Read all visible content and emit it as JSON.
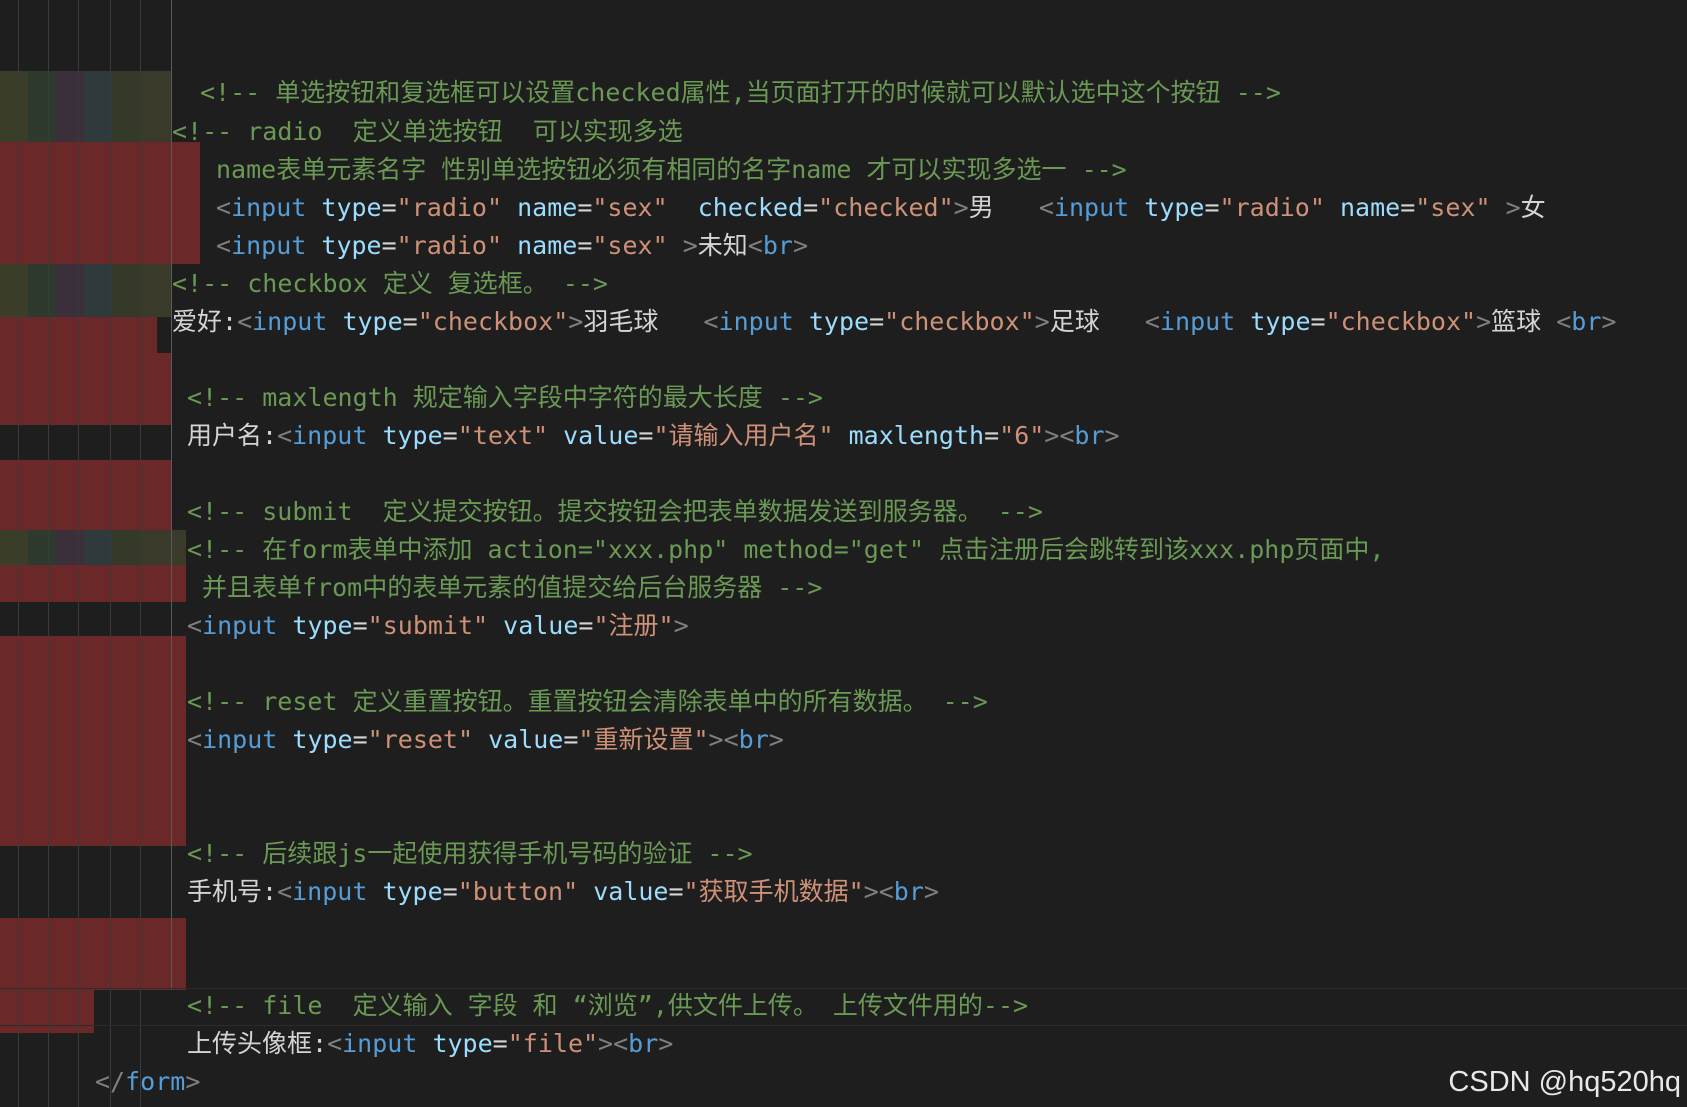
{
  "lines": {
    "l1": [
      "<!-- 单选按钮和复选框可以设置checked属性,当页面打开的时候就可以默认选中这个按钮 -->"
    ],
    "l2": [
      "<!-- radio  定义单选按钮  可以实现多选"
    ],
    "l3": [
      "name表单元素名字 性别单选按钮必须有相同的名字name 才可以实现多选一 -->"
    ],
    "l4": {
      "p1": "<",
      "t1": "input",
      "a1": "type",
      "eq1": "=",
      "v1": "\"radio\"",
      "a2": "name",
      "eq2": "=",
      "v2": "\"sex\"",
      "a3": "checked",
      "eq3": "=",
      "v3": "\"checked\"",
      "p2": ">",
      "tx1": "男",
      "p3": "<",
      "t2": "input",
      "a4": "type",
      "eq4": "=",
      "v4": "\"radio\"",
      "a5": "name",
      "eq5": "=",
      "v5": "\"sex\"",
      "p4": ">",
      "tx2": "女"
    },
    "l5": {
      "p1": "<",
      "t1": "input",
      "a1": "type",
      "eq1": "=",
      "v1": "\"radio\"",
      "a2": "name",
      "eq2": "=",
      "v2": "\"sex\"",
      "p2": ">",
      "tx1": "未知",
      "p3": "<",
      "t2": "br",
      "p4": ">"
    },
    "l6": [
      "<!-- checkbox 定义 复选框。 -->"
    ],
    "l7": {
      "tx0": "爱好:",
      "p1": "<",
      "t1": "input",
      "a1": "type",
      "eq1": "=",
      "v1": "\"checkbox\"",
      "p2": ">",
      "tx1": "羽毛球",
      "p3": "<",
      "t2": "input",
      "a2": "type",
      "eq2": "=",
      "v2": "\"checkbox\"",
      "p4": ">",
      "tx2": "足球",
      "p5": "<",
      "t3": "input",
      "a3": "type",
      "eq3": "=",
      "v3": "\"checkbox\"",
      "p6": ">",
      "tx3": "篮球",
      "p7": "<",
      "t4": "br",
      "p8": ">"
    },
    "l8": [
      "<!-- maxlength 规定输入字段中字符的最大长度 -->"
    ],
    "l9": {
      "tx0": "用户名:",
      "p1": "<",
      "t1": "input",
      "a1": "type",
      "eq1": "=",
      "v1": "\"text\"",
      "a2": "value",
      "eq2": "=",
      "v2": "\"请输入用户名\"",
      "a3": "maxlength",
      "eq3": "=",
      "v3": "\"6\"",
      "p2": ">",
      "p3": "<",
      "t2": "br",
      "p4": ">"
    },
    "l10": [
      "<!-- submit  定义提交按钮。提交按钮会把表单数据发送到服务器。 -->"
    ],
    "l11": [
      "<!-- 在form表单中添加 action=\"xxx.php\" method=\"get\" 点击注册后会跳转到该xxx.php页面中,"
    ],
    "l12": [
      "并且表单from中的表单元素的值提交给后台服务器 -->"
    ],
    "l13": {
      "p1": "<",
      "t1": "input",
      "a1": "type",
      "eq1": "=",
      "v1": "\"submit\"",
      "a2": "value",
      "eq2": "=",
      "v2": "\"注册\"",
      "p2": ">"
    },
    "l14": [
      "<!-- reset 定义重置按钮。重置按钮会清除表单中的所有数据。 -->"
    ],
    "l15": {
      "p1": "<",
      "t1": "input",
      "a1": "type",
      "eq1": "=",
      "v1": "\"reset\"",
      "a2": "value",
      "eq2": "=",
      "v2": "\"重新设置\"",
      "p2": ">",
      "p3": "<",
      "t2": "br",
      "p4": ">"
    },
    "l16": [
      "<!-- 后续跟js一起使用获得手机号码的验证 -->"
    ],
    "l17": {
      "tx0": "手机号:",
      "p1": "<",
      "t1": "input",
      "a1": "type",
      "eq1": "=",
      "v1": "\"button\"",
      "a2": "value",
      "eq2": "=",
      "v2": "\"获取手机数据\"",
      "p2": ">",
      "p3": "<",
      "t2": "br",
      "p4": ">"
    },
    "l18": [
      "<!-- file  定义输入 字段 和 “浏览”,供文件上传。 上传文件用的-->"
    ],
    "l19": {
      "tx0": "上传头像框:",
      "p1": "<",
      "t1": "input",
      "a1": "type",
      "eq1": "=",
      "v1": "\"file\"",
      "p2": ">",
      "p3": "<",
      "t2": "br",
      "p4": ">"
    },
    "l20": {
      "p1": "</",
      "t1": "form",
      "p2": ">"
    }
  },
  "watermark": "CSDN @hq520hq",
  "colors": {
    "background": "#1e1e1e",
    "comment": "#6a9955",
    "tag": "#569cd6",
    "attribute": "#9cdcfe",
    "string": "#ce9178",
    "punctuation": "#808080",
    "error_highlight": "#6a2828"
  }
}
